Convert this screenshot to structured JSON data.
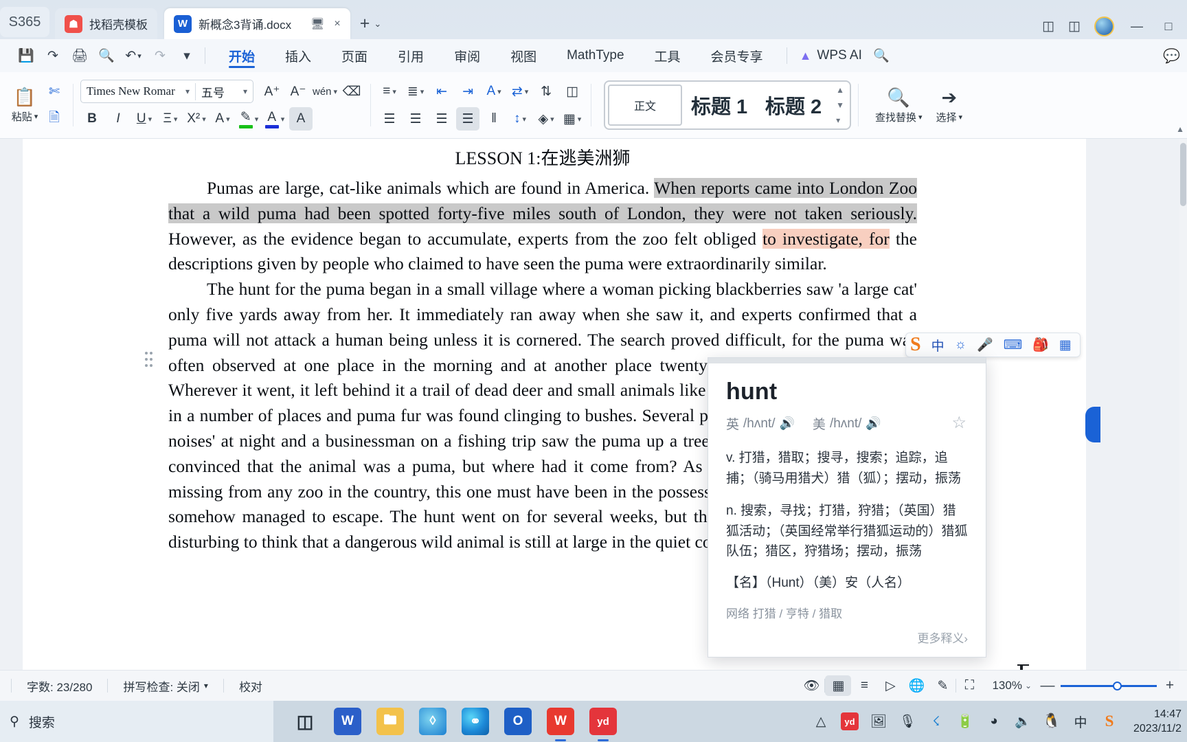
{
  "titlebar": {
    "left_chip": "S365",
    "tabs": [
      {
        "label": "找稻壳模板",
        "icon": "docer-icon",
        "active": false
      },
      {
        "label": "新概念3背诵.docx",
        "icon": "word-icon",
        "active": true
      }
    ],
    "tab_actions": {
      "monitor": "monitor-icon",
      "close": "×"
    },
    "new_tab": "+",
    "new_tab_caret": "⌄",
    "right_icons": [
      "panel-layout-icon",
      "cube-icon",
      "avatar",
      "minimize",
      "maximize"
    ],
    "minimize": "—",
    "maximize": "□"
  },
  "menubar": {
    "quick_icons": [
      "save-icon",
      "print-preview-link-icon",
      "print-icon",
      "search-doc-icon",
      "undo-icon",
      "redo-icon",
      "more-icon"
    ],
    "tabs": [
      {
        "label": "开始",
        "active": true
      },
      {
        "label": "插入",
        "active": false
      },
      {
        "label": "页面",
        "active": false
      },
      {
        "label": "引用",
        "active": false
      },
      {
        "label": "审阅",
        "active": false
      },
      {
        "label": "视图",
        "active": false
      },
      {
        "label": "MathType",
        "active": false
      },
      {
        "label": "工具",
        "active": false
      },
      {
        "label": "会员专享",
        "active": false
      }
    ],
    "wps_ai": "WPS AI",
    "search_icon": "search-icon",
    "comment_icon": "comment-icon"
  },
  "ribbon": {
    "paste_label": "粘贴",
    "font_name": "Times New Romar",
    "font_size": "五号",
    "grow_font": "A",
    "shrink_font": "A",
    "pinyin_guide": "wén",
    "clear_format": "clear-format-icon",
    "bold": "B",
    "italic": "I",
    "underline": "U",
    "strikethrough": "A",
    "superscript": "X²",
    "char_border": "A",
    "highlight": "A",
    "font_color": "A",
    "text_effect": "A",
    "styles": [
      {
        "label": "正文",
        "selected": true
      },
      {
        "label": "标题 1",
        "selected": false
      },
      {
        "label": "标题 2",
        "selected": false
      }
    ],
    "find_replace": "查找替换",
    "select": "选择"
  },
  "document": {
    "lesson_title": "LESSON 1:在逃美洲狮",
    "paragraph1_segments": [
      {
        "text": "Pumas are large, cat-like animals which are found in America. ",
        "highlight": "none"
      },
      {
        "text": "When reports came into London Zoo that a wild puma had been spotted forty-five miles south of London, they were not taken seriously.",
        "highlight": "gray"
      },
      {
        "text": " However, as the evidence began to accumulate, experts from the zoo felt obliged ",
        "highlight": "none"
      },
      {
        "text": "to investigate, for",
        "highlight": "pink"
      },
      {
        "text": " the descriptions given by people who claimed to have seen the puma were extraordinarily similar.",
        "highlight": "none"
      }
    ],
    "paragraph2": "The hunt for the puma began in a small village where a woman picking blackberries saw 'a large cat' only five yards away from her. It immediately ran away when she saw it, and experts confirmed that a puma will not attack a human being unless it is cornered. The search proved difficult, for the puma was often observed at one place in the morning and at another place twenty miles away in the evening. Wherever it went, it left behind it a trail of dead deer and small animals like rabbits. Paw prints were seen in a number of places and puma fur was found clinging to bushes. Several people complained of \"cat-like noises' at night and a businessman on a fishing trip saw the puma up a tree. The experts were now fully convinced that the animal was a puma, but where had it come from? As no pumas had been reported missing from any zoo in the country, this one must have been in the possession of a private collector and somehow managed to escape. The hunt went on for several weeks, but the puma was not caught. It is disturbing to think that a dangerous wild animal is still at large in the quiet countryside."
  },
  "ime": {
    "logo": "sogou-logo",
    "mode": "中",
    "items": [
      "voice-input-icon",
      "keyboard-icon",
      "skin-icon",
      "tools-grid-icon"
    ]
  },
  "dictionary": {
    "word": "hunt",
    "uk_label": "英",
    "uk_phonetic": "/hʌnt/",
    "us_label": "美",
    "us_phonetic": "/hʌnt/",
    "speaker_icon": "speaker-icon",
    "favorite_icon": "star-icon",
    "sense_verb": "v. 打猎，猎取；搜寻，搜索；追踪，追捕；（骑马用猎犬）猎（狐）；摆动，振荡",
    "sense_noun": "n. 搜索，寻找；打猎，狩猎；（英国）猎狐活动；（英国经常举行猎狐运动的）猎狐队伍；猎区，狩猎场；摆动，振荡",
    "sense_name": "【名】（Hunt）（美）安（人名）",
    "network_label": "网络",
    "network_value": "打猎 / 亨特 / 猎取",
    "more": "更多释义",
    "more_caret": "›"
  },
  "statusbar": {
    "word_count": "字数: 23/280",
    "spellcheck": "拼写检查: 关闭",
    "spellcheck_caret": "⌄",
    "proofread": "校对",
    "right_icons": [
      "eye-icon",
      "page-view-icon",
      "outline-view-icon",
      "read-view-icon",
      "web-view-icon",
      "edit-pen-icon",
      "fullscreen-icon"
    ],
    "zoom": "130%",
    "zoom_caret": "⌄",
    "zoom_out": "—",
    "zoom_in": "+"
  },
  "taskbar": {
    "search_placeholder": "搜索",
    "search_icon": "search-icon",
    "apps": [
      {
        "name": "task-view",
        "glyph": "task-view-icon"
      },
      {
        "name": "word",
        "glyph": "W"
      },
      {
        "name": "file-explorer",
        "glyph": "folder-icon"
      },
      {
        "name": "edge-legacy",
        "glyph": "e"
      },
      {
        "name": "edge",
        "glyph": "edge-icon"
      },
      {
        "name": "outlook",
        "glyph": "O"
      },
      {
        "name": "wps-office",
        "glyph": "W"
      },
      {
        "name": "youdao-dict",
        "glyph": "yd"
      }
    ],
    "tray": [
      "chevron-up-icon",
      "youdao-icon",
      "screenshot-icon",
      "microphone-icon",
      "bluetooth-icon",
      "battery-icon",
      "wifi-icon",
      "volume-icon",
      "qq-icon",
      "ime-chinese-icon",
      "sogou-icon"
    ],
    "ime_mode": "中",
    "time": "14:47",
    "date": "2023/11/2"
  },
  "colors": {
    "accent": "#1a62d6",
    "highlight_gray": "#c9c9c9",
    "highlight_pink": "#f8cfc0",
    "titlebar_bg": "#dde6ef",
    "taskbar_bg": "#ccd8e2"
  }
}
